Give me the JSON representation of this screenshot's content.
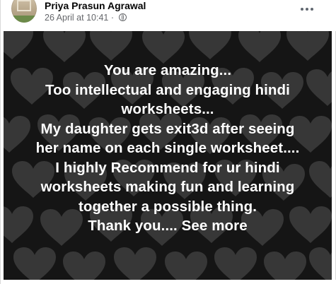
{
  "post": {
    "author_name": "Priya Prasun Agrawal",
    "timestamp": "26 April at 10:41",
    "separator": "·",
    "privacy_icon": "globe-icon",
    "more_icon": "more-options-icon",
    "body_lines": [
      "You are amazing...",
      "Too intellectual and engaging hindi",
      "worksheets...",
      "My daughter gets exit3d after seeing",
      "her name on each single worksheet....",
      "I highly Recommend for ur hindi",
      "worksheets making fun and learning",
      "together a possible thing.",
      "Thank you.... See more"
    ],
    "background_style": "dark hearts pattern",
    "colors": {
      "background": "#151515",
      "heart": "#3a3a3a",
      "text": "#ffffff",
      "author": "#050505",
      "meta": "#65676b"
    }
  }
}
